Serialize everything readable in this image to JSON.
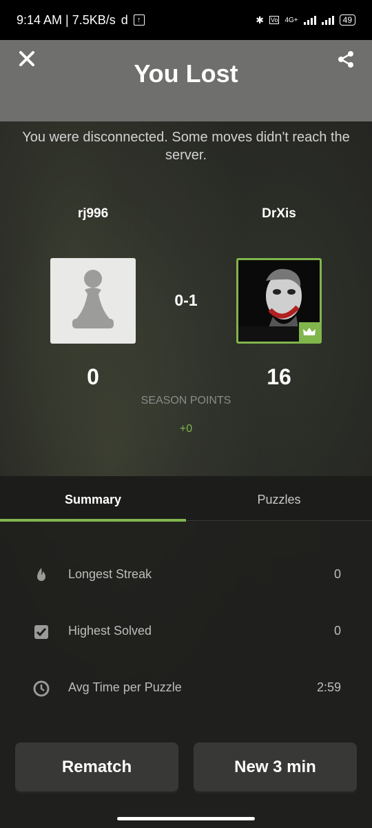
{
  "status_bar": {
    "time_and_speed": "9:14 AM | 7.5KB/s",
    "network": "4G+",
    "battery": "49"
  },
  "header": {
    "title": "You Lost"
  },
  "message": "You were disconnected. Some moves didn't reach the server.",
  "players": {
    "left": {
      "name": "rj996",
      "points": "0"
    },
    "right": {
      "name": "DrXis",
      "points": "16"
    }
  },
  "score": "0-1",
  "season": {
    "label": "SEASON POINTS",
    "delta": "+0"
  },
  "tabs": [
    {
      "label": "Summary"
    },
    {
      "label": "Puzzles"
    }
  ],
  "stats": [
    {
      "label": "Longest Streak",
      "value": "0",
      "icon": "flame-icon"
    },
    {
      "label": "Highest Solved",
      "value": "0",
      "icon": "checkbox-icon"
    },
    {
      "label": "Avg Time per Puzzle",
      "value": "2:59",
      "icon": "clock-icon"
    }
  ],
  "buttons": {
    "rematch": "Rematch",
    "new_game": "New 3 min"
  },
  "colors": {
    "accent": "#81b64c",
    "header_bg": "#6f6f6d",
    "button_bg": "#383836"
  }
}
